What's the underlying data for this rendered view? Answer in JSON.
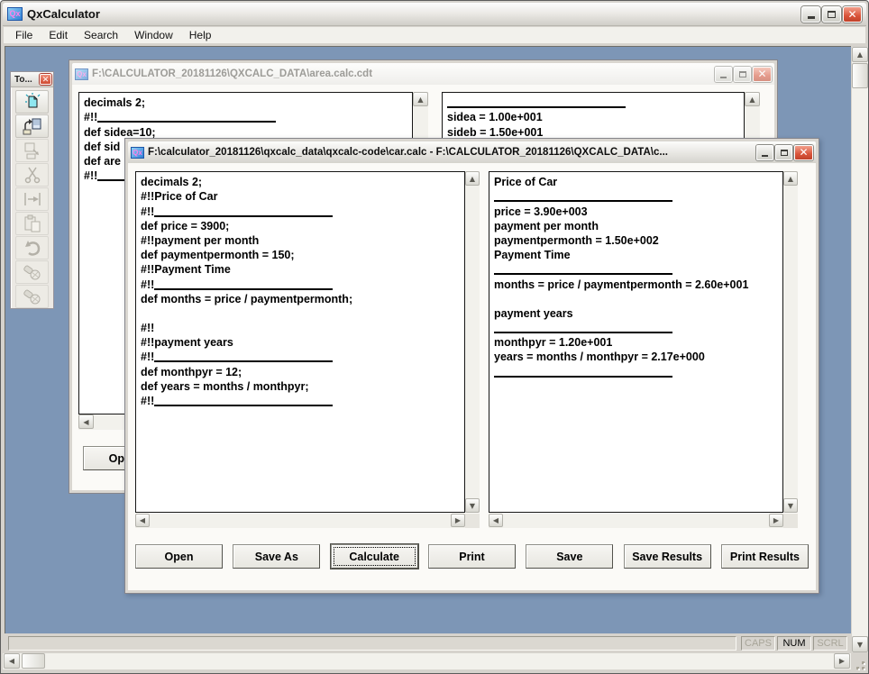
{
  "window": {
    "title": "QxCalculator",
    "icon_text": "Qx"
  },
  "menu": {
    "items": [
      "File",
      "Edit",
      "Search",
      "Window",
      "Help"
    ]
  },
  "toolbar": {
    "title": "To...",
    "buttons": [
      "new-file",
      "open-file",
      "copy-file",
      "cut",
      "insert",
      "paste",
      "undo",
      "find",
      "find-next"
    ]
  },
  "bg_window": {
    "title": "F:\\CALCULATOR_20181126\\QXCALC_DATA\\area.calc.cdt",
    "code_lines": [
      {
        "t": "decimals 2;"
      },
      {
        "t": "#!!",
        "r": true
      },
      {
        "t": "def sidea=10;"
      },
      {
        "t": "def sid"
      },
      {
        "t": "def are"
      },
      {
        "t": "#!!",
        "r": true
      }
    ],
    "result_lines": [
      {
        "t": "",
        "r": true
      },
      {
        "t": "sidea = 1.00e+001"
      },
      {
        "t": "sideb = 1.50e+001"
      }
    ],
    "open_button_label": "Op"
  },
  "fg_window": {
    "title": "F:\\calculator_20181126\\qxcalc_data\\qxcalc-code\\car.calc - F:\\CALCULATOR_20181126\\QXCALC_DATA\\c...",
    "code_lines": [
      {
        "t": "decimals 2;"
      },
      {
        "t": "#!!Price of Car"
      },
      {
        "t": "#!!",
        "r": true
      },
      {
        "t": "def price = 3900;"
      },
      {
        "t": "#!!payment per month"
      },
      {
        "t": "def paymentpermonth = 150;"
      },
      {
        "t": "#!!Payment Time"
      },
      {
        "t": "#!!",
        "r": true
      },
      {
        "t": "def months = price / paymentpermonth;"
      },
      {
        "t": ""
      },
      {
        "t": "#!!"
      },
      {
        "t": "#!!payment years"
      },
      {
        "t": "#!!",
        "r": true
      },
      {
        "t": "def monthpyr = 12;"
      },
      {
        "t": "def years = months / monthpyr;"
      },
      {
        "t": "#!!",
        "r": true
      }
    ],
    "result_lines": [
      {
        "t": "Price of Car"
      },
      {
        "t": "",
        "r": true
      },
      {
        "t": "price = 3.90e+003"
      },
      {
        "t": "payment per month"
      },
      {
        "t": "paymentpermonth = 1.50e+002"
      },
      {
        "t": "Payment Time"
      },
      {
        "t": "",
        "r": true
      },
      {
        "t": "months = price / paymentpermonth = 2.60e+001"
      },
      {
        "t": ""
      },
      {
        "t": "payment years"
      },
      {
        "t": "",
        "r": true
      },
      {
        "t": "monthpyr = 1.20e+001"
      },
      {
        "t": "years = months / monthpyr = 2.17e+000"
      },
      {
        "t": "",
        "r": true
      }
    ],
    "buttons": [
      "Open",
      "Save As",
      "Calculate",
      "Print",
      "Save",
      "Save Results",
      "Print Results"
    ],
    "focused_button": "Calculate"
  },
  "status_bar": {
    "message": "",
    "indicators": [
      {
        "label": "CAPS",
        "active": false
      },
      {
        "label": "NUM",
        "active": true
      },
      {
        "label": "SCRL",
        "active": false
      }
    ]
  },
  "colors": {
    "mdi_background": "#7d96b6",
    "titlebar_silver": "#d8d6d0",
    "close_red": "#d9543a",
    "panel_border": "#000000"
  }
}
